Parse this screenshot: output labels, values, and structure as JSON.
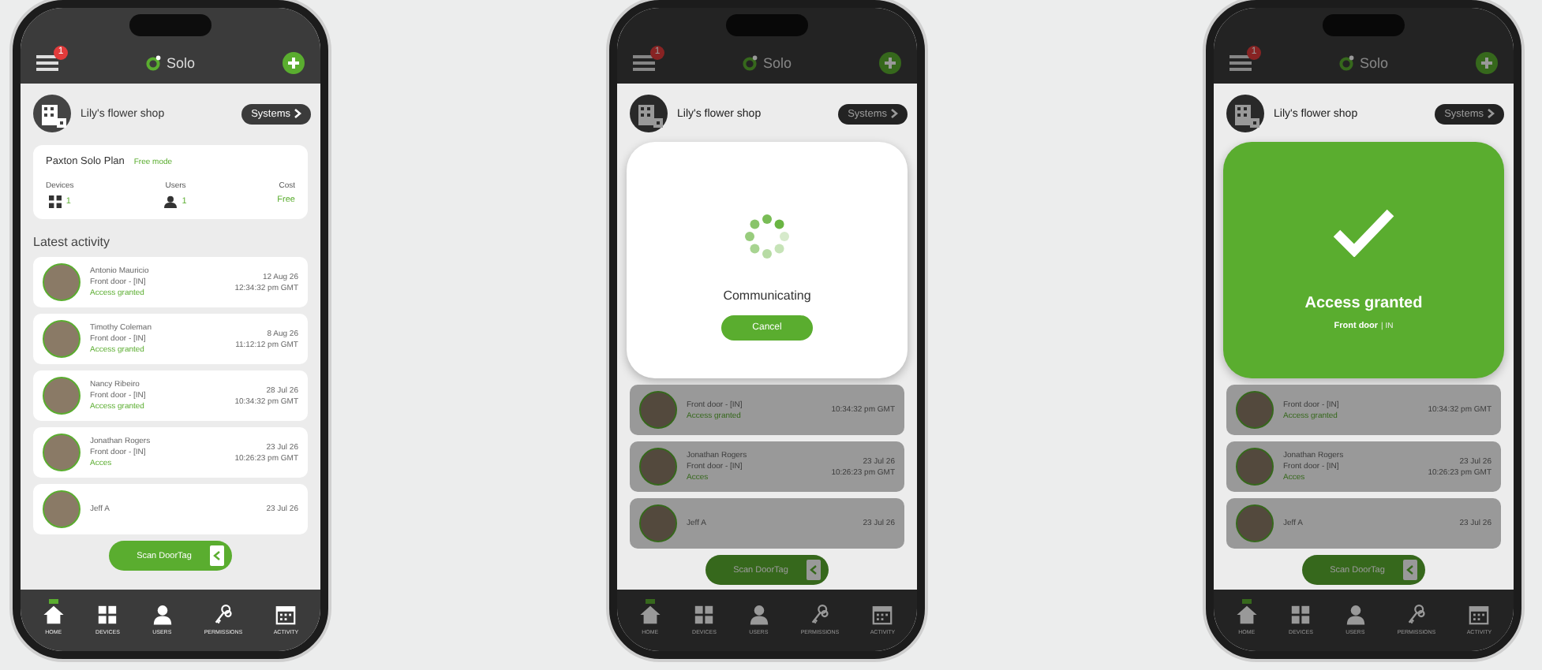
{
  "phones": [
    {
      "header": {
        "badge": "1",
        "logo": "Solo"
      },
      "shop": {
        "name": "Lily's flower shop",
        "systems_button": "Systems"
      },
      "plan": {
        "title": "Paxton Solo Plan",
        "mode": "Free mode",
        "stats": [
          {
            "kind": "devices",
            "label": "Devices",
            "value": "1"
          },
          {
            "kind": "users",
            "label": "Users",
            "value": "1"
          },
          {
            "kind": "cost",
            "label": "Cost",
            "value": "Free"
          }
        ]
      },
      "activity_title": "Latest activity",
      "activity": [
        {
          "name": "Antonio Mauricio",
          "door": "Front door - [IN]",
          "status": "Access granted",
          "date": "12 Aug 26",
          "time": "12:34:32 pm GMT"
        },
        {
          "name": "Timothy Coleman",
          "door": "Front door - [IN]",
          "status": "Access granted",
          "date": "8 Aug 26",
          "time": "11:12:12 pm GMT"
        },
        {
          "name": "Nancy Ribeiro",
          "door": "Front door - [IN]",
          "status": "Access granted",
          "date": "28 Jul 26",
          "time": "10:34:32 pm GMT"
        },
        {
          "name": "Jonathan Rogers",
          "door": "Front door - [IN]",
          "status": "Acces",
          "date": "23 Jul 26",
          "time": "10:26:23 pm GMT"
        },
        {
          "name": "Jeff A",
          "date": "23 Jul 26"
        }
      ],
      "scan_button": "Scan DoorTag",
      "tabs": [
        {
          "label": "HOME",
          "selected": true
        },
        {
          "label": "DEVICES",
          "selected": false
        },
        {
          "label": "USERS",
          "selected": false
        },
        {
          "label": "PERMISSIONS",
          "selected": false
        },
        {
          "label": "ACTIVITY",
          "selected": false
        }
      ]
    },
    {
      "header": {
        "badge": "1",
        "logo": "Solo"
      },
      "shop": {
        "name": "Lily's flower shop",
        "systems_button": "Systems"
      },
      "overlay": {
        "kind": "progress",
        "message": "Communicating",
        "button": "Cancel"
      },
      "activity": [
        {
          "door": "Front door - [IN]",
          "status": "Access granted",
          "time": "10:34:32 pm GMT"
        },
        {
          "name": "Jonathan Rogers",
          "door": "Front door - [IN]",
          "status": "Acces",
          "date": "23 Jul 26",
          "time": "10:26:23 pm GMT"
        },
        {
          "name": "Jeff A",
          "date": "23 Jul 26"
        }
      ],
      "scan_button": "Scan DoorTag",
      "tabs": [
        {
          "label": "HOME",
          "selected": true
        },
        {
          "label": "DEVICES",
          "selected": false
        },
        {
          "label": "USERS",
          "selected": false
        },
        {
          "label": "PERMISSIONS",
          "selected": false
        },
        {
          "label": "ACTIVITY",
          "selected": false
        }
      ]
    },
    {
      "header": {
        "badge": "1",
        "logo": "Solo"
      },
      "shop": {
        "name": "Lily's flower shop",
        "systems_button": "Systems"
      },
      "overlay": {
        "kind": "success",
        "title": "Access granted",
        "door": "Front door",
        "direction": "| IN"
      },
      "activity": [
        {
          "door": "Front door - [IN]",
          "status": "Access granted",
          "time": "10:34:32 pm GMT"
        },
        {
          "name": "Jonathan Rogers",
          "door": "Front door - [IN]",
          "status": "Acces",
          "date": "23 Jul 26",
          "time": "10:26:23 pm GMT"
        },
        {
          "name": "Jeff A",
          "date": "23 Jul 26"
        }
      ],
      "scan_button": "Scan DoorTag",
      "tabs": [
        {
          "label": "HOME",
          "selected": true
        },
        {
          "label": "DEVICES",
          "selected": false
        },
        {
          "label": "USERS",
          "selected": false
        },
        {
          "label": "PERMISSIONS",
          "selected": false
        },
        {
          "label": "ACTIVITY",
          "selected": false
        }
      ]
    }
  ]
}
